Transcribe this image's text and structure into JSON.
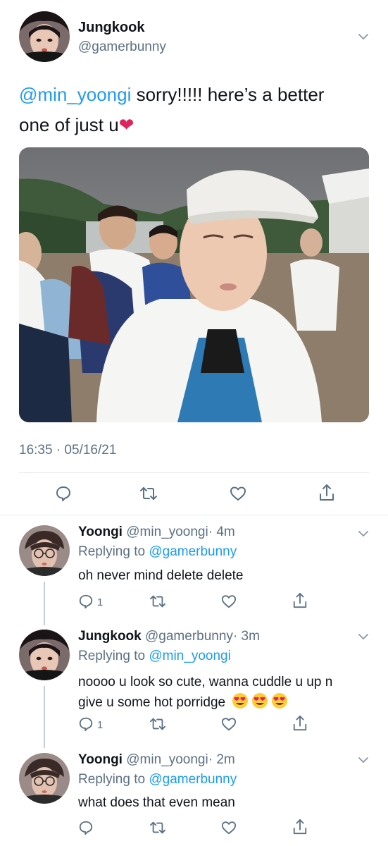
{
  "main_tweet": {
    "display_name": "Jungkook",
    "handle": "@gamerbunny",
    "mention": "@min_yoongi",
    "text_line1": " sorry!!!!! here’s a better",
    "text_line2": "one of just u",
    "heart_emoji": "❤",
    "timestamp": "16:35 · 05/16/21",
    "actions": [
      "reply-icon",
      "retweet-icon",
      "like-icon",
      "share-icon"
    ]
  },
  "replies": [
    {
      "display_name": "Yoongi",
      "handle": "@min_yoongi",
      "age": "· 4m",
      "replying_label": "Replying to",
      "replying_to": "@gamerbunny",
      "text": "oh never mind delete delete",
      "reply_count": "1"
    },
    {
      "display_name": "Jungkook",
      "handle": "@gamerbunny",
      "age": "· 3m",
      "replying_label": "Replying to",
      "replying_to": "@min_yoongi",
      "text_line1": "noooo u look so cute, wanna cuddle u up n",
      "text_line2": "give u some hot porridge",
      "emojis": [
        "heart-eyes-emoji",
        "heart-eyes-emoji",
        "heart-eyes-emoji"
      ],
      "reply_count": "1"
    },
    {
      "display_name": "Yoongi",
      "handle": "@min_yoongi",
      "age": "· 2m",
      "replying_label": "Replying to",
      "replying_to": "@gamerbunny",
      "text": "what does that even mean",
      "reply_count": ""
    }
  ],
  "colors": {
    "link_blue": "#1d9bf0",
    "secondary_text": "#5b7083",
    "divider": "#e6ecf0",
    "heart_red": "#e0245e"
  }
}
